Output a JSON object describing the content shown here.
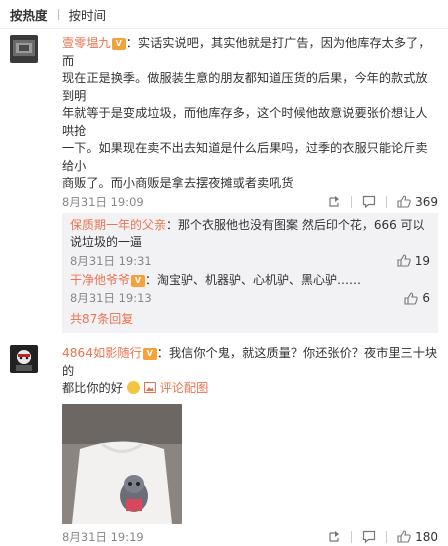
{
  "sort": {
    "hot": "按热度",
    "time": "按时间"
  },
  "comments": [
    {
      "user": "壹零塭九",
      "text_lines": [
        "：实话实说吧，其实他就是打广告，因为他库存太多了，而",
        "现在正是换季。做服装生意的朋友都知道压货的后果，今年的款式放到明",
        "年就等于是变成垃圾，而他库存多，这个时候他故意说要张价想让人哄抢",
        "一下。如果现在卖不出去知道是什么后果吗，过季的衣服只能论斤卖给小",
        "商贩了。而小商贩是拿去摆夜摊或者卖吼货"
      ],
      "time": "8月31日 19:09",
      "likes": "369",
      "replies": [
        {
          "user": "保质期一年的父亲",
          "text": "：那个衣服他也没有图案 然后印个花，666 可以",
          "text2": "说垃圾的一逼",
          "time": "8月31日 19:31",
          "likes": "19"
        },
        {
          "user": "干净他爷爷",
          "text": "：淘宝驴、机器驴、心机驴、黑心驴……",
          "time": "8月31日 19:13",
          "likes": "6"
        }
      ],
      "more": "共87条回复"
    },
    {
      "user": "4864如影随行",
      "text_lines": [
        "：我信你个鬼，就这质量？你还张价？夜市里三十块的",
        "都比你的好"
      ],
      "pic_link": "评论配图",
      "time": "8月31日 19:19",
      "likes": "180"
    }
  ],
  "colors": {
    "accent": "#eb7350",
    "reply_bg": "#f2f2f5"
  }
}
